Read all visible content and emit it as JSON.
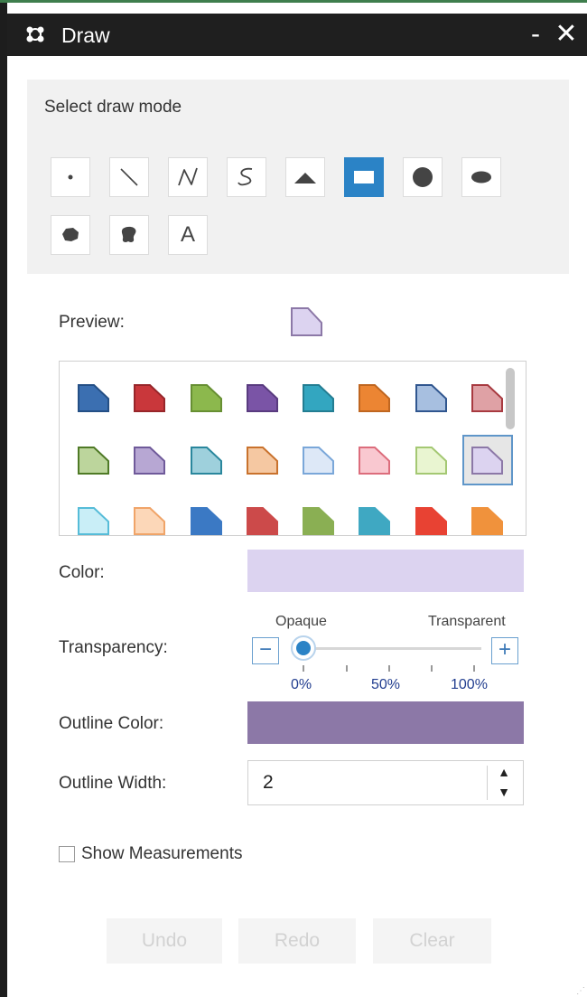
{
  "window": {
    "title": "Draw",
    "minimize_label": "-",
    "close_label": "✕",
    "icon": "draw-widget-icon"
  },
  "draw_mode": {
    "heading": "Select draw mode",
    "tools": [
      {
        "name": "point",
        "icon": "point-icon",
        "active": false
      },
      {
        "name": "line",
        "icon": "line-icon",
        "active": false
      },
      {
        "name": "polyline",
        "icon": "polyline-icon",
        "active": false
      },
      {
        "name": "freehand-polyline",
        "icon": "freehand-polyline-icon",
        "active": false
      },
      {
        "name": "triangle",
        "icon": "triangle-icon",
        "active": false
      },
      {
        "name": "rectangle",
        "icon": "rectangle-icon",
        "active": true
      },
      {
        "name": "circle",
        "icon": "circle-icon",
        "active": false
      },
      {
        "name": "ellipse",
        "icon": "ellipse-icon",
        "active": false
      },
      {
        "name": "polygon",
        "icon": "polygon-icon",
        "active": false
      },
      {
        "name": "freehand-polygon",
        "icon": "freehand-polygon-icon",
        "active": false
      },
      {
        "name": "text",
        "icon": "text-icon",
        "label": "A",
        "active": false
      }
    ]
  },
  "preview": {
    "label": "Preview:"
  },
  "palette": {
    "selected_index": 15,
    "swatches": [
      {
        "fill": "#3b6fb1",
        "stroke": "#244f85"
      },
      {
        "fill": "#c9373b",
        "stroke": "#97262a"
      },
      {
        "fill": "#8cb84d",
        "stroke": "#678f33"
      },
      {
        "fill": "#7a54a6",
        "stroke": "#593b7f"
      },
      {
        "fill": "#33a6c0",
        "stroke": "#237d92"
      },
      {
        "fill": "#ec8533",
        "stroke": "#bf6620"
      },
      {
        "fill": "#a7bfe0",
        "stroke": "#30568f"
      },
      {
        "fill": "#dfa1a5",
        "stroke": "#a83a40"
      },
      {
        "fill": "#bcd59c",
        "stroke": "#4f7a26"
      },
      {
        "fill": "#b7a7d3",
        "stroke": "#6f5a9a"
      },
      {
        "fill": "#9ed0dc",
        "stroke": "#2a879d"
      },
      {
        "fill": "#f5c8a2",
        "stroke": "#c9722d"
      },
      {
        "fill": "#dde8f7",
        "stroke": "#7aa7d9"
      },
      {
        "fill": "#f9c8d0",
        "stroke": "#dc6d7c"
      },
      {
        "fill": "#e9f5d1",
        "stroke": "#a4c873"
      },
      {
        "fill": "#dcd3f0",
        "stroke": "#8c78a7"
      },
      {
        "fill": "#c9eef7",
        "stroke": "#56bcd8"
      },
      {
        "fill": "#fcd7b8",
        "stroke": "#f0a468"
      },
      {
        "fill": "#3b79c4",
        "stroke": "#3b79c4"
      },
      {
        "fill": "#cc4a4a",
        "stroke": "#cc4a4a"
      },
      {
        "fill": "#8aaf53",
        "stroke": "#8aaf53"
      },
      {
        "fill": "#3fa8c2",
        "stroke": "#3fa8c2"
      },
      {
        "fill": "#e84233",
        "stroke": "#e84233"
      },
      {
        "fill": "#f0923c",
        "stroke": "#f0923c"
      }
    ]
  },
  "color": {
    "label": "Color:",
    "value": "#dcd3f0"
  },
  "transparency": {
    "label": "Transparency:",
    "left_label": "Opaque",
    "right_label": "Transparent",
    "decrease_label": "−",
    "increase_label": "+",
    "ticks": [
      "0%",
      "50%",
      "100%"
    ],
    "value_percent": 0
  },
  "outline_color": {
    "label": "Outline Color:",
    "value": "#8c78a7"
  },
  "outline_width": {
    "label": "Outline Width:",
    "value": "2",
    "up": "▲",
    "down": "▼"
  },
  "measurements": {
    "label": "Show Measurements",
    "checked": false
  },
  "actions": {
    "undo": "Undo",
    "redo": "Redo",
    "clear": "Clear"
  }
}
